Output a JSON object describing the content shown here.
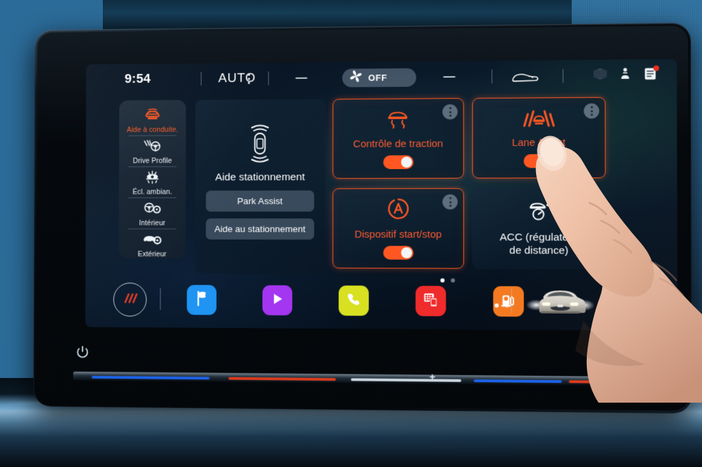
{
  "statusbar": {
    "time": "9:54",
    "auto_label": "AUTO",
    "kebab_icon": "vertical-dots-icon",
    "left_temp": "––",
    "right_temp": "––",
    "fan": {
      "icon": "fan-icon",
      "label": "OFF"
    },
    "rear_window_icon": "car-rear-defrost-icon",
    "icons_right": [
      {
        "name": "globe-icon",
        "glyph": "globe"
      },
      {
        "name": "user-profile-icon",
        "glyph": "person"
      },
      {
        "name": "notifications-icon",
        "glyph": "list",
        "badge": true
      }
    ]
  },
  "sidebar": {
    "items": [
      {
        "label": "Aide à conduite.",
        "icon": "driving-assist-icon",
        "active": true
      },
      {
        "label": "Drive Profile",
        "icon": "steering-wheel-icon",
        "active": false
      },
      {
        "label": "Écl. ambian.",
        "icon": "ambient-light-icon",
        "active": false
      },
      {
        "label": "Intérieur",
        "icon": "interior-settings-icon",
        "active": false
      },
      {
        "label": "Extérieur",
        "icon": "exterior-settings-icon",
        "active": false
      }
    ]
  },
  "tiles": {
    "park": {
      "title": "Aide stationnement",
      "icon": "parking-sensors-car-icon",
      "buttons": [
        {
          "label": "Park Assist",
          "name": "park-assist-button"
        },
        {
          "label": "Aide au stationnement",
          "name": "parking-aid-button"
        }
      ]
    },
    "traction": {
      "title": "Contrôle de traction",
      "icon": "traction-control-icon",
      "toggle_on": true,
      "active": true
    },
    "lane": {
      "title": "Lane Assist",
      "icon": "lane-assist-icon",
      "toggle_on": true,
      "active": true
    },
    "startstop": {
      "title": "Dispositif start/stop",
      "icon": "auto-start-stop-icon",
      "toggle_on": true,
      "active": true
    },
    "acc": {
      "title": "ACC (régulateur\nde distance)",
      "title_line1": "ACC (régulateur",
      "title_line2": "de distance)",
      "icon": "adaptive-cruise-control-icon",
      "toggle_on": false,
      "active": false
    },
    "page_dots": {
      "count": 2,
      "active_index": 0
    }
  },
  "dock": {
    "home": {
      "name": "home-button",
      "icon": "three-slashes-icon"
    },
    "apps": [
      {
        "name": "navigation-app",
        "icon": "flag-icon",
        "color": "#1f94f2"
      },
      {
        "name": "media-app",
        "icon": "play-icon",
        "color": "#a435f0"
      },
      {
        "name": "phone-app",
        "icon": "phone-icon",
        "color": "#d8e021"
      },
      {
        "name": "apps-grid-app",
        "icon": "apps-grid-icon",
        "color": "#ef2b2b"
      },
      {
        "name": "fuel-app",
        "icon": "fuel-pump-icon",
        "color": "#f47920"
      }
    ],
    "page_dots": {
      "count": 2,
      "active_index": 0
    },
    "car_preview": "car-front-render"
  },
  "bezel": {
    "power_icon": "power-button-icon",
    "plus_label": "+"
  },
  "colors": {
    "accent_orange": "#ff5722",
    "accent_orange_text": "#ff5b33",
    "screen_bg": "#081422",
    "dash_blue": "#2b6b99"
  }
}
